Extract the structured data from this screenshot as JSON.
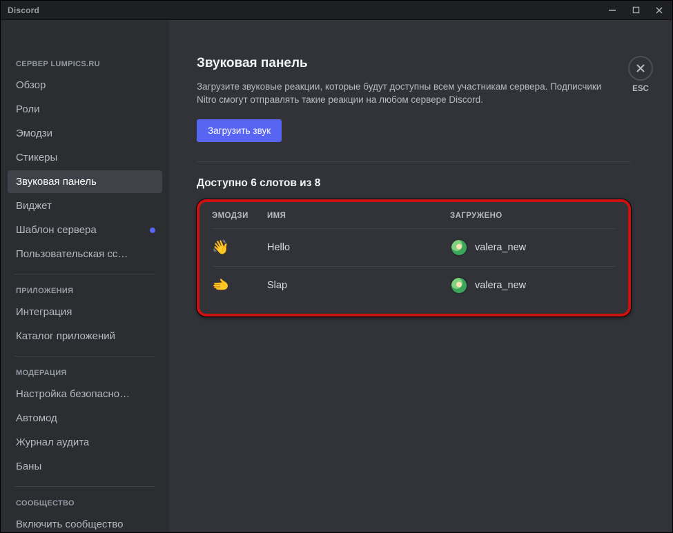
{
  "titlebar": {
    "appname": "Discord"
  },
  "sidebar": {
    "categories": [
      {
        "header": "СЕРВЕР LUMPICS.RU",
        "items": [
          {
            "label": "Обзор",
            "active": false,
            "badge": false
          },
          {
            "label": "Роли",
            "active": false,
            "badge": false
          },
          {
            "label": "Эмодзи",
            "active": false,
            "badge": false
          },
          {
            "label": "Стикеры",
            "active": false,
            "badge": false
          },
          {
            "label": "Звуковая панель",
            "active": true,
            "badge": false
          },
          {
            "label": "Виджет",
            "active": false,
            "badge": false
          },
          {
            "label": "Шаблон сервера",
            "active": false,
            "badge": true
          },
          {
            "label": "Пользовательская сс…",
            "active": false,
            "badge": false
          }
        ]
      },
      {
        "header": "ПРИЛОЖЕНИЯ",
        "items": [
          {
            "label": "Интеграция",
            "active": false,
            "badge": false
          },
          {
            "label": "Каталог приложений",
            "active": false,
            "badge": false
          }
        ]
      },
      {
        "header": "МОДЕРАЦИЯ",
        "items": [
          {
            "label": "Настройка безопасно…",
            "active": false,
            "badge": false
          },
          {
            "label": "Автомод",
            "active": false,
            "badge": false
          },
          {
            "label": "Журнал аудита",
            "active": false,
            "badge": false
          },
          {
            "label": "Баны",
            "active": false,
            "badge": false
          }
        ]
      },
      {
        "header": "СООБЩЕСТВО",
        "items": [
          {
            "label": "Включить сообщество",
            "active": false,
            "badge": false
          }
        ]
      }
    ]
  },
  "close": {
    "esc_label": "ESC"
  },
  "page": {
    "title": "Звуковая панель",
    "description": "Загрузите звуковые реакции, которые будут доступны всем участникам сервера. Подписчики Nitro смогут отправлять такие реакции на любом сервере Discord.",
    "upload_label": "Загрузить звук",
    "slots_label": "Доступно 6 слотов из 8",
    "columns": {
      "emoji": "ЭМОДЗИ",
      "name": "ИМЯ",
      "uploaded": "ЗАГРУЖЕНО"
    },
    "rows": [
      {
        "emoji": "👋",
        "name": "Hello",
        "uploader": "valera_new"
      },
      {
        "emoji": "🫲",
        "name": "Slap",
        "uploader": "valera_new"
      }
    ]
  }
}
